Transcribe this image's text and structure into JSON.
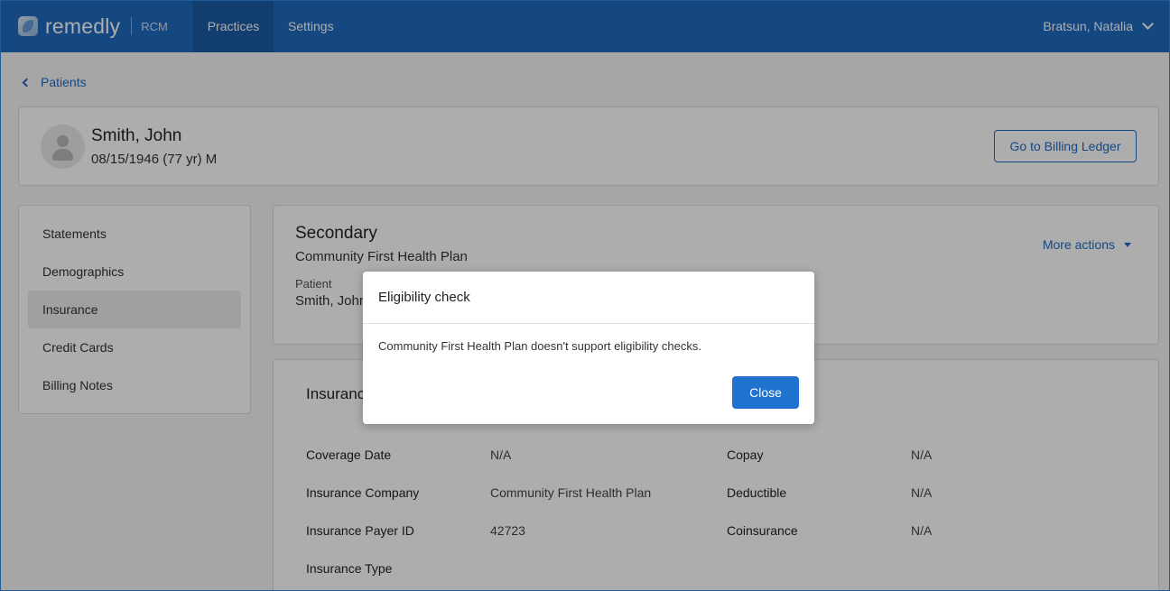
{
  "app": {
    "name": "remedly",
    "product": "RCM"
  },
  "nav": {
    "items": [
      {
        "label": "Practices"
      },
      {
        "label": "Settings"
      }
    ],
    "user": "Bratsun, Natalia"
  },
  "breadcrumb": {
    "label": "Patients"
  },
  "patient": {
    "name": "Smith, John",
    "dob_line": "08/15/1946 (77 yr) M",
    "billing_button": "Go to Billing Ledger"
  },
  "sidebar": {
    "items": [
      {
        "label": "Statements"
      },
      {
        "label": "Demographics"
      },
      {
        "label": "Insurance",
        "active": true
      },
      {
        "label": "Credit Cards"
      },
      {
        "label": "Billing Notes"
      }
    ]
  },
  "insurance": {
    "title": "Secondary",
    "plan": "Community First Health Plan",
    "patient_label": "Patient",
    "patient_value": "Smith, John",
    "more_actions": "More actions"
  },
  "details": {
    "title": "Insurance",
    "left": [
      {
        "label": "Coverage Date",
        "value": "N/A"
      },
      {
        "label": "Insurance Company",
        "value": "Community First Health Plan"
      },
      {
        "label": "Insurance Payer ID",
        "value": "42723"
      },
      {
        "label": "Insurance Type",
        "value": ""
      }
    ],
    "right": [
      {
        "label": "Copay",
        "value": "N/A"
      },
      {
        "label": "Deductible",
        "value": "N/A"
      },
      {
        "label": "Coinsurance",
        "value": "N/A"
      }
    ]
  },
  "modal": {
    "title": "Eligibility check",
    "message": "Community First Health Plan doesn't support eligibility checks.",
    "close_label": "Close"
  },
  "colors": {
    "brand": "#1f6bbf",
    "primary_button": "#1f73cf"
  }
}
